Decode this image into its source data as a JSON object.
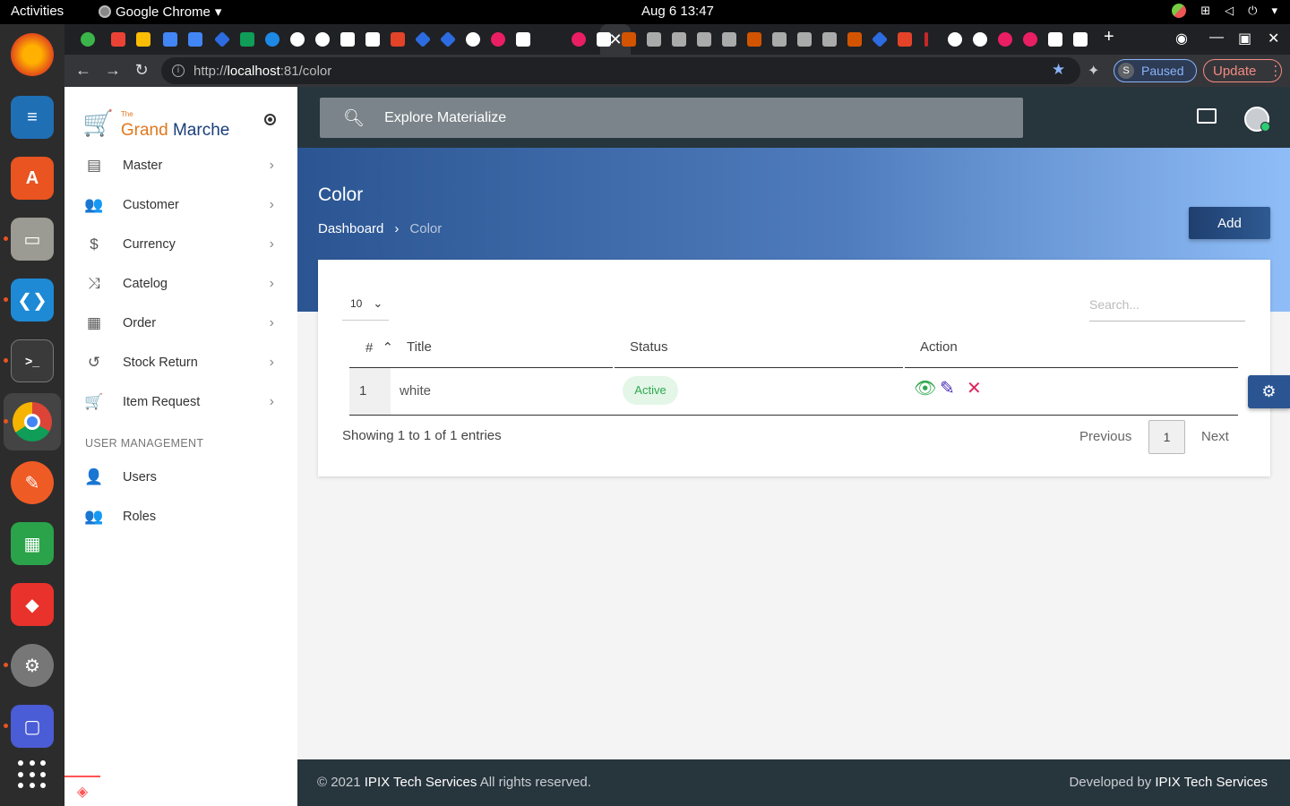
{
  "os": {
    "activities": "Activities",
    "app_name": "Google Chrome",
    "clock": "Aug 6  13:47"
  },
  "browser": {
    "url_scheme": "http://",
    "url_host": "localhost",
    "url_path": ":81/color",
    "profile_initial": "S",
    "profile_status": "Paused",
    "update_label": "Update",
    "active_tab_close": "✕",
    "new_tab": "+"
  },
  "brand": {
    "prefix": "The",
    "name_part1": "Grand",
    "name_part2": "Marche"
  },
  "sidebar": {
    "items": [
      {
        "label": "Master",
        "icon": "list-icon"
      },
      {
        "label": "Customer",
        "icon": "people-icon"
      },
      {
        "label": "Currency",
        "icon": "dollar-icon"
      },
      {
        "label": "Catelog",
        "icon": "shuffle-icon"
      },
      {
        "label": "Order",
        "icon": "calendar-icon"
      },
      {
        "label": "Stock Return",
        "icon": "history-icon"
      },
      {
        "label": "Item Request",
        "icon": "cart-icon"
      }
    ],
    "section_label": "USER MANAGEMENT",
    "user_items": [
      {
        "label": "Users",
        "icon": "person-icon"
      },
      {
        "label": "Roles",
        "icon": "people-icon"
      }
    ]
  },
  "header": {
    "search_placeholder": "Explore Materialize"
  },
  "page": {
    "title": "Color",
    "breadcrumb": [
      "Dashboard",
      "Color"
    ],
    "add_label": "Add"
  },
  "table": {
    "page_length": "10",
    "search_placeholder": "Search...",
    "columns": [
      "#",
      "Title",
      "Status",
      "Action"
    ],
    "rows": [
      {
        "index": "1",
        "title": "white",
        "status": "Active"
      }
    ],
    "info": "Showing 1 to 1 of 1 entries",
    "prev_label": "Previous",
    "current_page": "1",
    "next_label": "Next"
  },
  "footer": {
    "copyright_prefix": "© 2021",
    "company": "IPIX Tech Services",
    "rights": "All rights reserved.",
    "developed_by": "Developed by"
  },
  "colors": {
    "header_bg": "#27353d",
    "accent": "#2b5592",
    "status_active": "#2fa84f",
    "view_icon": "#2fa84f",
    "edit_icon": "#4a2db8",
    "delete_icon": "#e0245e"
  }
}
